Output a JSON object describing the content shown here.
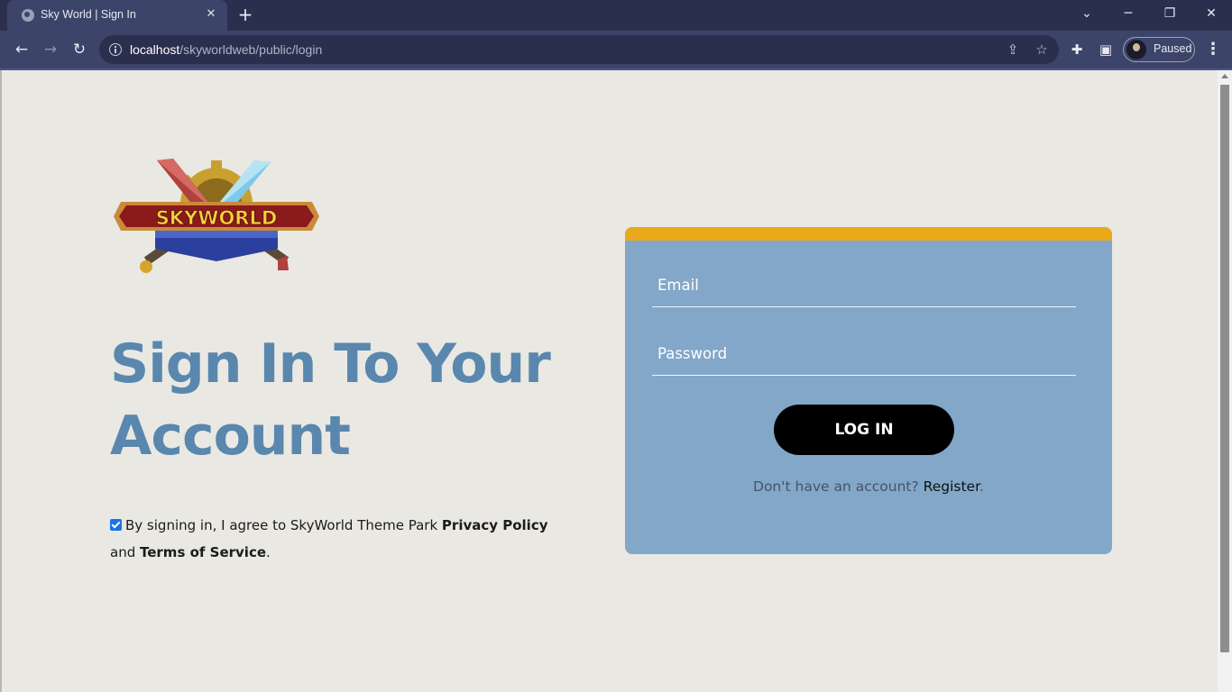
{
  "browser": {
    "tab_title": "Sky World | Sign In",
    "new_tab_label": "+",
    "url_host": "localhost",
    "url_path": "/skyworldweb/public/login",
    "profile_label": "Paused"
  },
  "logo": {
    "text": "SKYWORLD",
    "colors": {
      "banner": "#8b1a1a",
      "ribbon": "#2a3f9e",
      "gold": "#d4a52a",
      "sword_left": "#b0413e",
      "sword_right": "#7ec8e8"
    }
  },
  "main": {
    "heading": "Sign In To Your Account",
    "terms_prefix": "By signing in, I agree to SkyWorld Theme Park ",
    "privacy_policy": "Privacy Policy",
    "terms_and": " and ",
    "terms_of_service": "Terms of Service",
    "terms_suffix": ".",
    "terms_checked": true
  },
  "login_form": {
    "email_placeholder": "Email",
    "password_placeholder": "Password",
    "login_button": "LOG IN",
    "register_prompt": "Don't have an account? ",
    "register_link": "Register",
    "register_suffix": "."
  },
  "colors": {
    "page_bg": "#e9e8e3",
    "heading": "#5a87ad",
    "card_bg": "#82a7c9",
    "card_accent": "#eba81a",
    "button_bg": "#000000"
  }
}
